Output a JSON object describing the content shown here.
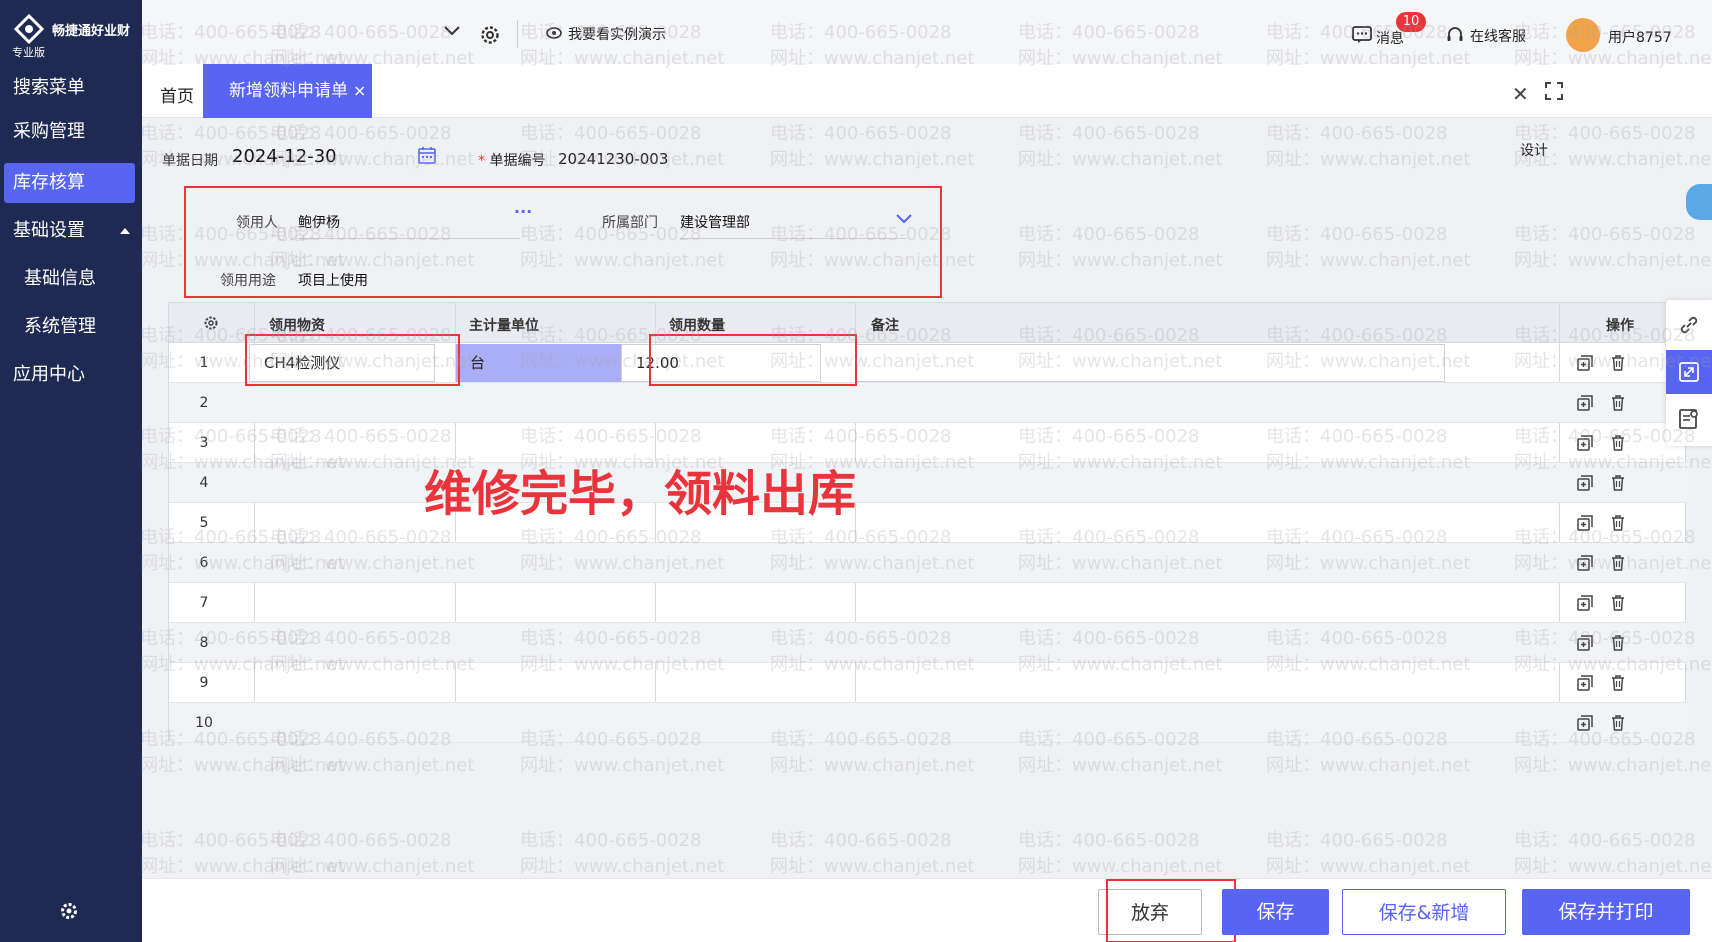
{
  "app": {
    "brand": "畅捷通好业财",
    "edition": "专业版"
  },
  "sidebar": {
    "items": [
      {
        "label": "搜索菜单"
      },
      {
        "label": "采购管理"
      },
      {
        "label": "库存核算",
        "active": true
      },
      {
        "label": "基础设置"
      },
      {
        "label": "基础信息"
      },
      {
        "label": "系统管理"
      },
      {
        "label": "应用中心"
      }
    ]
  },
  "topbar": {
    "demo": "我要看实例演示",
    "messages": "消息",
    "message_count": "10",
    "service": "在线客服",
    "user": "用户8757"
  },
  "tabs": {
    "home": "首页",
    "active": "新增领料申请单",
    "close_glyph": "×"
  },
  "header": {
    "date_label": "单据日期",
    "date_value": "2024-12-30",
    "required_mark": "*",
    "number_label": "单据编号",
    "number_value": "20241230-003",
    "design": "设计"
  },
  "form": {
    "recipient_label": "领用人",
    "recipient_value": "鲍伊杨",
    "dept_label": "所属部门",
    "dept_value": "建设管理部",
    "purpose_label": "领用用途",
    "purpose_value": "项目上使用"
  },
  "grid": {
    "headers": {
      "material": "领用物资",
      "unit": "主计量单位",
      "qty": "领用数量",
      "note": "备注",
      "ops": "操作"
    },
    "rows": [
      {
        "no": "1",
        "material": "CH4检测仪",
        "unit": "台",
        "qty": "12.00"
      },
      {
        "no": "2"
      },
      {
        "no": "3"
      },
      {
        "no": "4"
      },
      {
        "no": "5"
      },
      {
        "no": "6"
      },
      {
        "no": "7"
      },
      {
        "no": "8"
      },
      {
        "no": "9"
      },
      {
        "no": "10"
      }
    ]
  },
  "annotation": "维修完毕，领料出库",
  "footer": {
    "discard": "放弃",
    "save": "保存",
    "save_new": "保存&新增",
    "save_print": "保存并打印"
  },
  "watermark": {
    "phone": "电话：400-665-0028",
    "site": "网址：www.chanjet.net"
  },
  "colors": {
    "sidebar": "#1f2a52",
    "accent": "#5865f2",
    "highlight": "#e8343a"
  }
}
